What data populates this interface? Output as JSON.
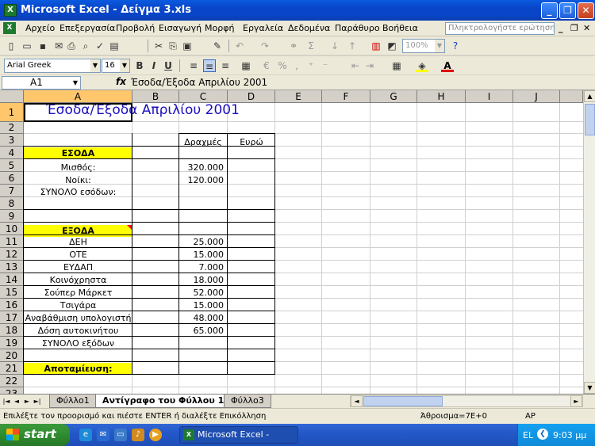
{
  "window": {
    "title": "Microsoft Excel - Δείγμα 3.xls",
    "minimize": "_",
    "restore": "❐",
    "close": "✕"
  },
  "menu": [
    "Αρχείο",
    "Επεξεργασία",
    "Προβολή",
    "Εισαγωγή",
    "Μορφή",
    "Εργαλεία",
    "Δεδομένα",
    "Παράθυρο",
    "Βοήθεια"
  ],
  "ask_placeholder": "Πληκτρολογήστε ερώτηση",
  "toolbar": {
    "zoom": "100%",
    "font": "Arial Greek",
    "size": "16"
  },
  "formula_bar": {
    "name_box": "A1",
    "fx": "fx",
    "value": "Έσοδα/Έξοδα Απριλίου 2001"
  },
  "columns": [
    "A",
    "B",
    "C",
    "D",
    "E",
    "F",
    "G",
    "H",
    "I",
    "J"
  ],
  "rows": [
    "1",
    "2",
    "3",
    "4",
    "5",
    "6",
    "7",
    "8",
    "9",
    "10",
    "11",
    "12",
    "13",
    "14",
    "15",
    "16",
    "17",
    "18",
    "19",
    "20",
    "21",
    "22",
    "23"
  ],
  "sheet": {
    "title": "Έσοδα/Έξοδα Απριλίου 2001",
    "hdr_drachmas": "Δραχμές",
    "hdr_euro": "Ευρώ",
    "income_label": "ΕΣΟΔΑ",
    "income": [
      {
        "label": "Μισθός:",
        "value": "320.000"
      },
      {
        "label": "Νοίκι:",
        "value": "120.000"
      },
      {
        "label": "ΣΥΝΟΛΟ εσόδων:",
        "value": ""
      }
    ],
    "expense_label": "ΕΞΟΔΑ",
    "expenses": [
      {
        "label": "ΔΕΗ",
        "value": "25.000"
      },
      {
        "label": "ΟΤΕ",
        "value": "15.000"
      },
      {
        "label": "ΕΥΔΑΠ",
        "value": "7.000"
      },
      {
        "label": "Κοινόχρηστα",
        "value": "18.000"
      },
      {
        "label": "Σούπερ Μάρκετ",
        "value": "52.000"
      },
      {
        "label": "Τσιγάρα",
        "value": "15.000"
      },
      {
        "label": "Αναβάθμιση υπολογιστή",
        "value": "48.000"
      },
      {
        "label": "Δόση αυτοκινήτου",
        "value": "65.000"
      },
      {
        "label": "ΣΥΝΟΛΟ εξόδων",
        "value": ""
      }
    ],
    "savings_label": "Αποταμίευση:"
  },
  "tabs": [
    "Φύλλο1",
    "Αντίγραφο του Φύλλου 1",
    "Φύλλο3"
  ],
  "tab_nav": [
    "|◄",
    "◄",
    "►",
    "►|"
  ],
  "status": {
    "message": "Επιλέξτε τον προορισμό και πιέστε ENTER ή διαλέξτε Επικόλληση",
    "sum": "Άθροισμα=7E+0",
    "mode": "ΑΡ"
  },
  "taskbar": {
    "start": "start",
    "item": "Microsoft Excel - Δείγ...",
    "lang": "EL",
    "time": "9:03 μμ"
  }
}
